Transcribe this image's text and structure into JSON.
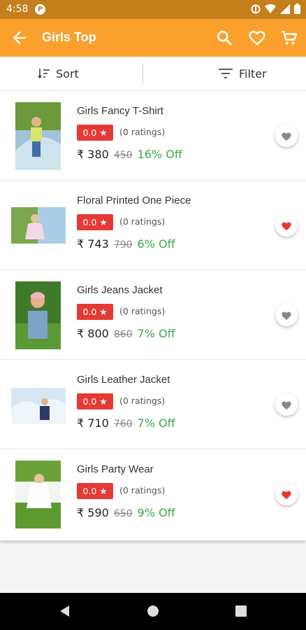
{
  "status_bar": {
    "time": "4:58"
  },
  "app_bar": {
    "title": "Girls Top"
  },
  "toolbar": {
    "sort_label": "Sort",
    "filter_label": "Filter"
  },
  "currency": "₹",
  "colors": {
    "primary": "#f9a12c",
    "status_bar": "#c47f1c",
    "rating_bg": "#e53935",
    "discount": "#3aa845",
    "fav_active": "#e53935",
    "fav_inactive": "#888888"
  },
  "products": [
    {
      "name": "Girls Fancy T-Shirt",
      "rating": "0.0",
      "ratings_count": "(0 ratings)",
      "price": "₹ 380",
      "mrp": "450",
      "discount": "16% Off",
      "favorite": false
    },
    {
      "name": "Floral Printed One Piece",
      "rating": "0.0",
      "ratings_count": "(0 ratings)",
      "price": "₹ 743",
      "mrp": "790",
      "discount": "6% Off",
      "favorite": true
    },
    {
      "name": "Girls Jeans Jacket",
      "rating": "0.0",
      "ratings_count": "(0 ratings)",
      "price": "₹ 800",
      "mrp": "860",
      "discount": "7% Off",
      "favorite": false
    },
    {
      "name": "Girls Leather Jacket",
      "rating": "0.0",
      "ratings_count": "(0 ratings)",
      "price": "₹ 710",
      "mrp": "760",
      "discount": "7% Off",
      "favorite": false
    },
    {
      "name": "Girls Party Wear",
      "rating": "0.0",
      "ratings_count": "(0 ratings)",
      "price": "₹ 590",
      "mrp": "650",
      "discount": "9% Off",
      "favorite": true
    }
  ],
  "icons": {
    "back": "arrow-left-icon",
    "search": "search-icon",
    "wishlist": "heart-outline-icon",
    "cart": "cart-icon",
    "sort": "sort-icon",
    "filter": "filter-icon",
    "star": "star-icon",
    "fav": "heart-icon"
  }
}
